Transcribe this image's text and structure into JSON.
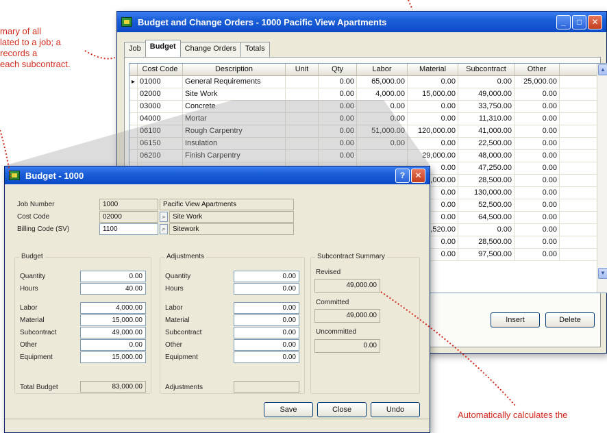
{
  "callouts": {
    "left": [
      "mary of all",
      "lated to a job; a",
      "records a",
      "each subcontract."
    ],
    "bottom": [
      "Automatically calculates the"
    ]
  },
  "main_window": {
    "title": "Budget and Change Orders - 1000   Pacific View Apartments",
    "tabs": [
      "Job",
      "Budget",
      "Change Orders",
      "Totals"
    ],
    "active_tab": "Budget",
    "columns": [
      "Cost Code",
      "Description",
      "Unit",
      "Qty",
      "Labor",
      "Material",
      "Subcontract",
      "Other"
    ],
    "rows": [
      {
        "code": "01000",
        "desc": "General Requirements",
        "unit": "",
        "qty": "0.00",
        "labor": "65,000.00",
        "material": "0.00",
        "sub": "0.00",
        "other": "25,000.00"
      },
      {
        "code": "02000",
        "desc": "Site Work",
        "unit": "",
        "qty": "0.00",
        "labor": "4,000.00",
        "material": "15,000.00",
        "sub": "49,000.00",
        "other": "0.00"
      },
      {
        "code": "03000",
        "desc": "Concrete",
        "unit": "",
        "qty": "0.00",
        "labor": "0.00",
        "material": "0.00",
        "sub": "33,750.00",
        "other": "0.00"
      },
      {
        "code": "04000",
        "desc": "Mortar",
        "unit": "",
        "qty": "0.00",
        "labor": "0.00",
        "material": "0.00",
        "sub": "11,310.00",
        "other": "0.00"
      },
      {
        "code": "06100",
        "desc": "Rough Carpentry",
        "unit": "",
        "qty": "0.00",
        "labor": "51,000.00",
        "material": "120,000.00",
        "sub": "41,000.00",
        "other": "0.00"
      },
      {
        "code": "06150",
        "desc": "Insulation",
        "unit": "",
        "qty": "0.00",
        "labor": "0.00",
        "material": "0.00",
        "sub": "22,500.00",
        "other": "0.00"
      },
      {
        "code": "06200",
        "desc": "Finish Carpentry",
        "unit": "",
        "qty": "0.00",
        "labor": "",
        "material": "29,000.00",
        "sub": "48,000.00",
        "other": "0.00"
      },
      {
        "code": "",
        "desc": "",
        "unit": "",
        "qty": "",
        "labor": "",
        "material": "0.00",
        "sub": "47,250.00",
        "other": "0.00"
      },
      {
        "code": "",
        "desc": "",
        "unit": "",
        "qty": "",
        "labor": "",
        "material": "18,000.00",
        "sub": "28,500.00",
        "other": "0.00"
      },
      {
        "code": "",
        "desc": "",
        "unit": "",
        "qty": "",
        "labor": "",
        "material": "0.00",
        "sub": "130,000.00",
        "other": "0.00"
      },
      {
        "code": "",
        "desc": "",
        "unit": "",
        "qty": "",
        "labor": "",
        "material": "0.00",
        "sub": "52,500.00",
        "other": "0.00"
      },
      {
        "code": "",
        "desc": "",
        "unit": "",
        "qty": "",
        "labor": "",
        "material": "0.00",
        "sub": "64,500.00",
        "other": "0.00"
      },
      {
        "code": "",
        "desc": "",
        "unit": "",
        "qty": "",
        "labor": "",
        "material": "21,520.00",
        "sub": "0.00",
        "other": "0.00"
      },
      {
        "code": "",
        "desc": "",
        "unit": "",
        "qty": "",
        "labor": "",
        "material": "0.00",
        "sub": "28,500.00",
        "other": "0.00"
      },
      {
        "code": "",
        "desc": "",
        "unit": "",
        "qty": "",
        "labor": "",
        "material": "0.00",
        "sub": "97,500.00",
        "other": "0.00"
      }
    ],
    "insert_label": "Insert",
    "delete_label": "Delete"
  },
  "budget_dialog": {
    "title": "Budget - 1000",
    "job_number_label": "Job Number",
    "job_number": "1000",
    "job_name": "Pacific View Apartments",
    "cost_code_label": "Cost Code",
    "cost_code": "02000",
    "cost_code_desc": "Site Work",
    "billing_code_label": "Billing Code (SV)",
    "billing_code": "1100",
    "billing_code_desc": "Sitework",
    "budget_group": "Budget",
    "adjust_group": "Adjustments",
    "subcontract_group": "Subcontract Summary",
    "quantity_label": "Quantity",
    "hours_label": "Hours",
    "labor_label": "Labor",
    "material_label": "Material",
    "subcontract_label": "Subcontract",
    "other_label": "Other",
    "equipment_label": "Equipment",
    "budget": {
      "quantity": "0.00",
      "hours": "40.00",
      "labor": "4,000.00",
      "material": "15,000.00",
      "subcontract": "49,000.00",
      "other": "0.00",
      "equipment": "15,000.00"
    },
    "adjust": {
      "quantity": "0.00",
      "hours": "0.00",
      "labor": "0.00",
      "material": "0.00",
      "subcontract": "0.00",
      "other": "0.00",
      "equipment": "0.00"
    },
    "total_budget_label": "Total Budget",
    "total_budget": "83,000.00",
    "adjustments_label": "Adjustments",
    "adjustments_total": "",
    "revised_label": "Revised",
    "revised": "49,000.00",
    "committed_label": "Committed",
    "committed": "49,000.00",
    "uncommitted_label": "Uncommitted",
    "uncommitted": "0.00",
    "save_label": "Save",
    "close_label": "Close",
    "undo_label": "Undo"
  }
}
